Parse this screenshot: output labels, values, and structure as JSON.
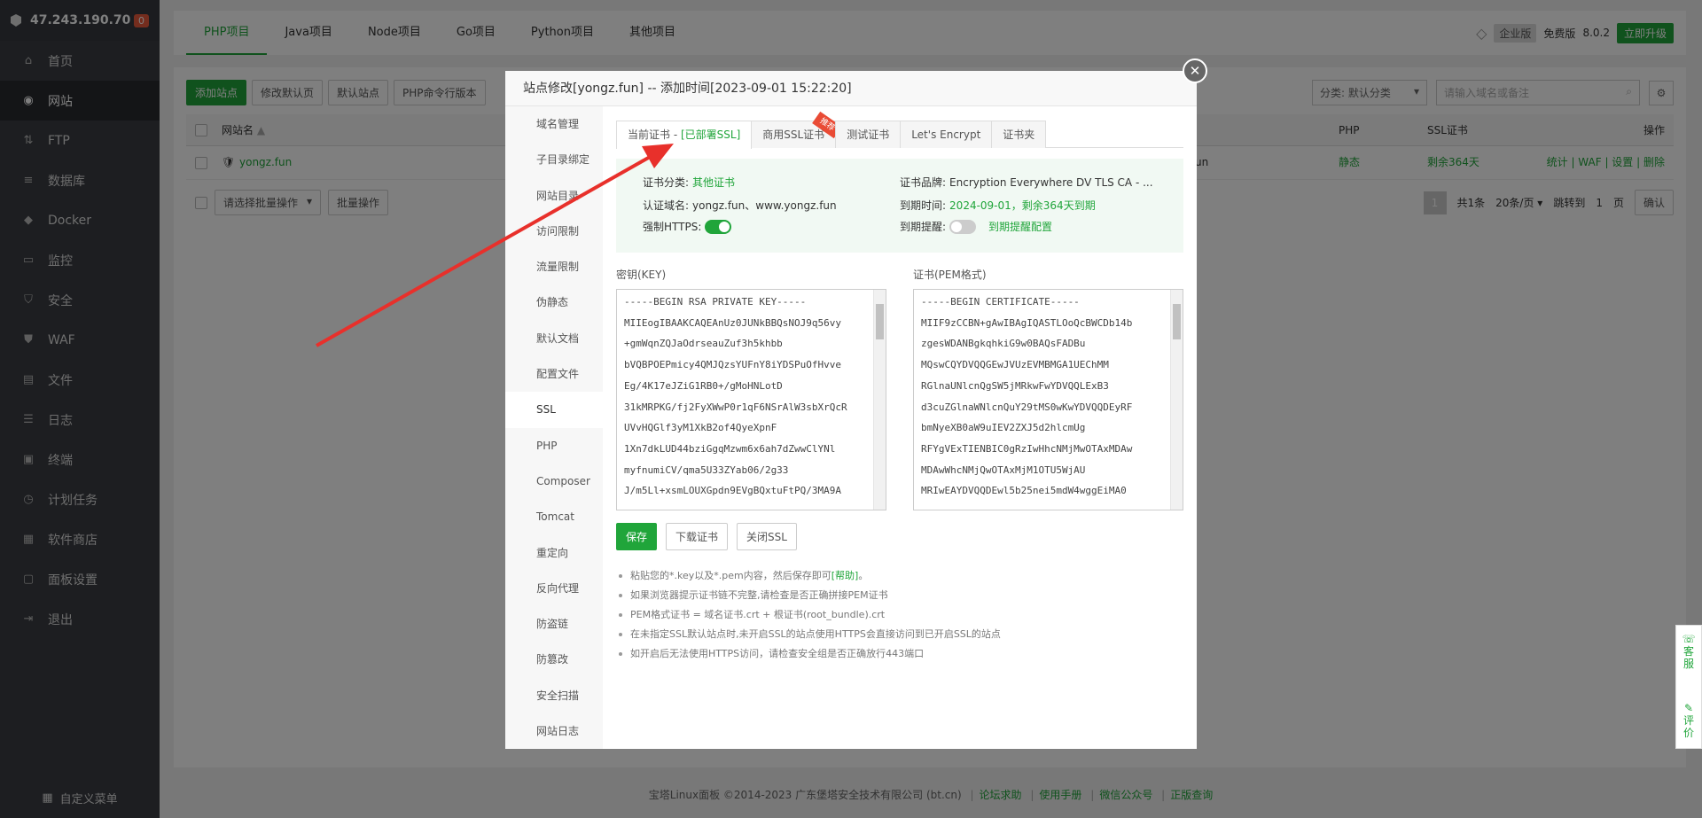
{
  "sidebar": {
    "server_ip": "47.243.190.70",
    "badge": "0",
    "items": [
      {
        "label": "首页",
        "icon": "home-icon"
      },
      {
        "label": "网站",
        "icon": "globe-icon"
      },
      {
        "label": "FTP",
        "icon": "ftp-icon"
      },
      {
        "label": "数据库",
        "icon": "database-icon"
      },
      {
        "label": "Docker",
        "icon": "docker-icon"
      },
      {
        "label": "监控",
        "icon": "monitor-icon"
      },
      {
        "label": "安全",
        "icon": "shield-icon"
      },
      {
        "label": "WAF",
        "icon": "waf-icon"
      },
      {
        "label": "文件",
        "icon": "folder-icon"
      },
      {
        "label": "日志",
        "icon": "log-icon"
      },
      {
        "label": "终端",
        "icon": "terminal-icon"
      },
      {
        "label": "计划任务",
        "icon": "clock-icon"
      },
      {
        "label": "软件商店",
        "icon": "grid-icon"
      },
      {
        "label": "面板设置",
        "icon": "settings-icon"
      },
      {
        "label": "退出",
        "icon": "logout-icon"
      }
    ],
    "active_index": 1,
    "custom_menu": "自定义菜单"
  },
  "topbar": {
    "tabs": [
      "PHP项目",
      "Java项目",
      "Node项目",
      "Go项目",
      "Python项目",
      "其他项目"
    ],
    "enterprise": "企业版",
    "free": "免费版",
    "version": "8.0.2",
    "upgrade": "立即升级"
  },
  "site_list": {
    "buttons": [
      "添加站点",
      "修改默认页",
      "默认站点",
      "PHP命令行版本"
    ],
    "category": "分类: 默认分类",
    "search_placeholder": "请输入域名或备注",
    "headers": {
      "name": "网站名",
      "php": "PHP",
      "ssl": "SSL证书",
      "ops": "操作"
    },
    "row": {
      "name": "yongz.fun",
      "backup_tail": ".fun",
      "php": "静态",
      "ssl": "剩余364天",
      "ops": [
        "统计",
        "WAF",
        "设置",
        "删除"
      ]
    },
    "batch_select": "请选择批量操作",
    "batch_btn": "批量操作",
    "pager": {
      "page": "1",
      "total": "共1条",
      "per_page": "20条/页",
      "jump": "跳转到",
      "jump_page": "1",
      "page_unit": "页",
      "confirm": "确认"
    }
  },
  "footer": {
    "copyright": "宝塔Linux面板 ©2014-2023 广东堡塔安全技术有限公司 (bt.cn)",
    "links": [
      "论坛求助",
      "使用手册",
      "微信公众号",
      "正版查询"
    ]
  },
  "service": {
    "kefu": "客服",
    "pingjia": "评价"
  },
  "modal": {
    "title": "站点修改[yongz.fun] -- 添加时间[2023-09-01 15:22:20]",
    "nav": [
      "域名管理",
      "子目录绑定",
      "网站目录",
      "访问限制",
      "流量限制",
      "伪静态",
      "默认文档",
      "配置文件",
      "SSL",
      "PHP",
      "Composer",
      "Tomcat",
      "重定向",
      "反向代理",
      "防盗链",
      "防篡改",
      "安全扫描",
      "网站日志"
    ],
    "nav_active": 8,
    "tabs": {
      "current_prefix": "当前证书 - ",
      "current_status": "[已部署SSL]",
      "commercial": "商用SSL证书",
      "recommend": "推荐",
      "test": "测试证书",
      "letsencrypt": "Let's Encrypt",
      "folder": "证书夹"
    },
    "cert_info": {
      "category_label": "证书分类:",
      "category_value": "其他证书",
      "brand_label": "证书品牌:",
      "brand_value": "Encryption Everywhere DV TLS CA - ...",
      "domain_label": "认证域名:",
      "domain_value": "yongz.fun、www.yongz.fun",
      "expire_label": "到期时间:",
      "expire_value": "2024-09-01，剩余364天到期",
      "https_label": "强制HTTPS:",
      "remind_label": "到期提醒:",
      "remind_link": "到期提醒配置"
    },
    "key_title": "密钥(KEY)",
    "key_lines": [
      "-----BEGIN RSA PRIVATE KEY-----",
      "MIIEogIBAAKCAQEAnUz0JUNkBBQsNOJ9q56vy",
      "+gmWqnZQJaOdrseauZuf3h5khbb",
      "bVQBPOEPmicy4QMJQzsYUFnY8iYDSPuOfHvve",
      "Eg/4K17eJZiG1RB0+/gMoHNLotD",
      "31kMRPKG/fj2FyXWwP0r1qF6NSrAlW3sbXrQcR",
      "UVvHQGlf3yM1XkB2of4QyeXpnF",
      "1Xn7dkLUD44bziGgqMzwm6x6ah7dZwwClYNl",
      "myfnumiCV/qma5U33ZYab06/2g33",
      "J/m5Ll+xsmLOUXGpdn9EVgBQxtuFtPQ/3MA9A"
    ],
    "cert_title": "证书(PEM格式)",
    "cert_lines": [
      "-----BEGIN CERTIFICATE-----",
      "MIIF9zCCBN+gAwIBAgIQASTLOoQcBWCDb14b",
      "zgesWDANBgkqhkiG9w0BAQsFADBu",
      "MQswCQYDVQQGEwJVUzEVMBMGA1UEChMM",
      "RGlnaUNlcnQgSW5jMRkwFwYDVQQLExB3",
      "d3cuZGlnaWNlcnQuY29tMS0wKwYDVQQDEyRF",
      "bmNyeXB0aW9uIEV2ZXJ5d2hlcmUg",
      "RFYgVExTIENBIC0gRzIwHhcNMjMwOTAxMDAw",
      "MDAwWhcNMjQwOTAxMjM1OTU5WjAU",
      "MRIwEAYDVQQDEwl5b25nei5mdW4wggEiMA0"
    ],
    "buttons": {
      "save": "保存",
      "download": "下载证书",
      "close_ssl": "关闭SSL"
    },
    "tips": [
      {
        "text": "粘贴您的*.key以及*.pem内容，然后保存即可",
        "link": "[帮助]",
        "tail": "。"
      },
      {
        "text": "如果浏览器提示证书链不完整,请检查是否正确拼接PEM证书"
      },
      {
        "text": "PEM格式证书 = 域名证书.crt + 根证书(root_bundle).crt"
      },
      {
        "text": "在未指定SSL默认站点时,未开启SSL的站点使用HTTPS会直接访问到已开启SSL的站点"
      },
      {
        "text": "如开启后无法使用HTTPS访问，请检查安全组是否正确放行443端口"
      }
    ]
  },
  "colors": {
    "accent": "#20a53a",
    "arrow": "#e8302b",
    "sidebar": "#3a3d42"
  }
}
